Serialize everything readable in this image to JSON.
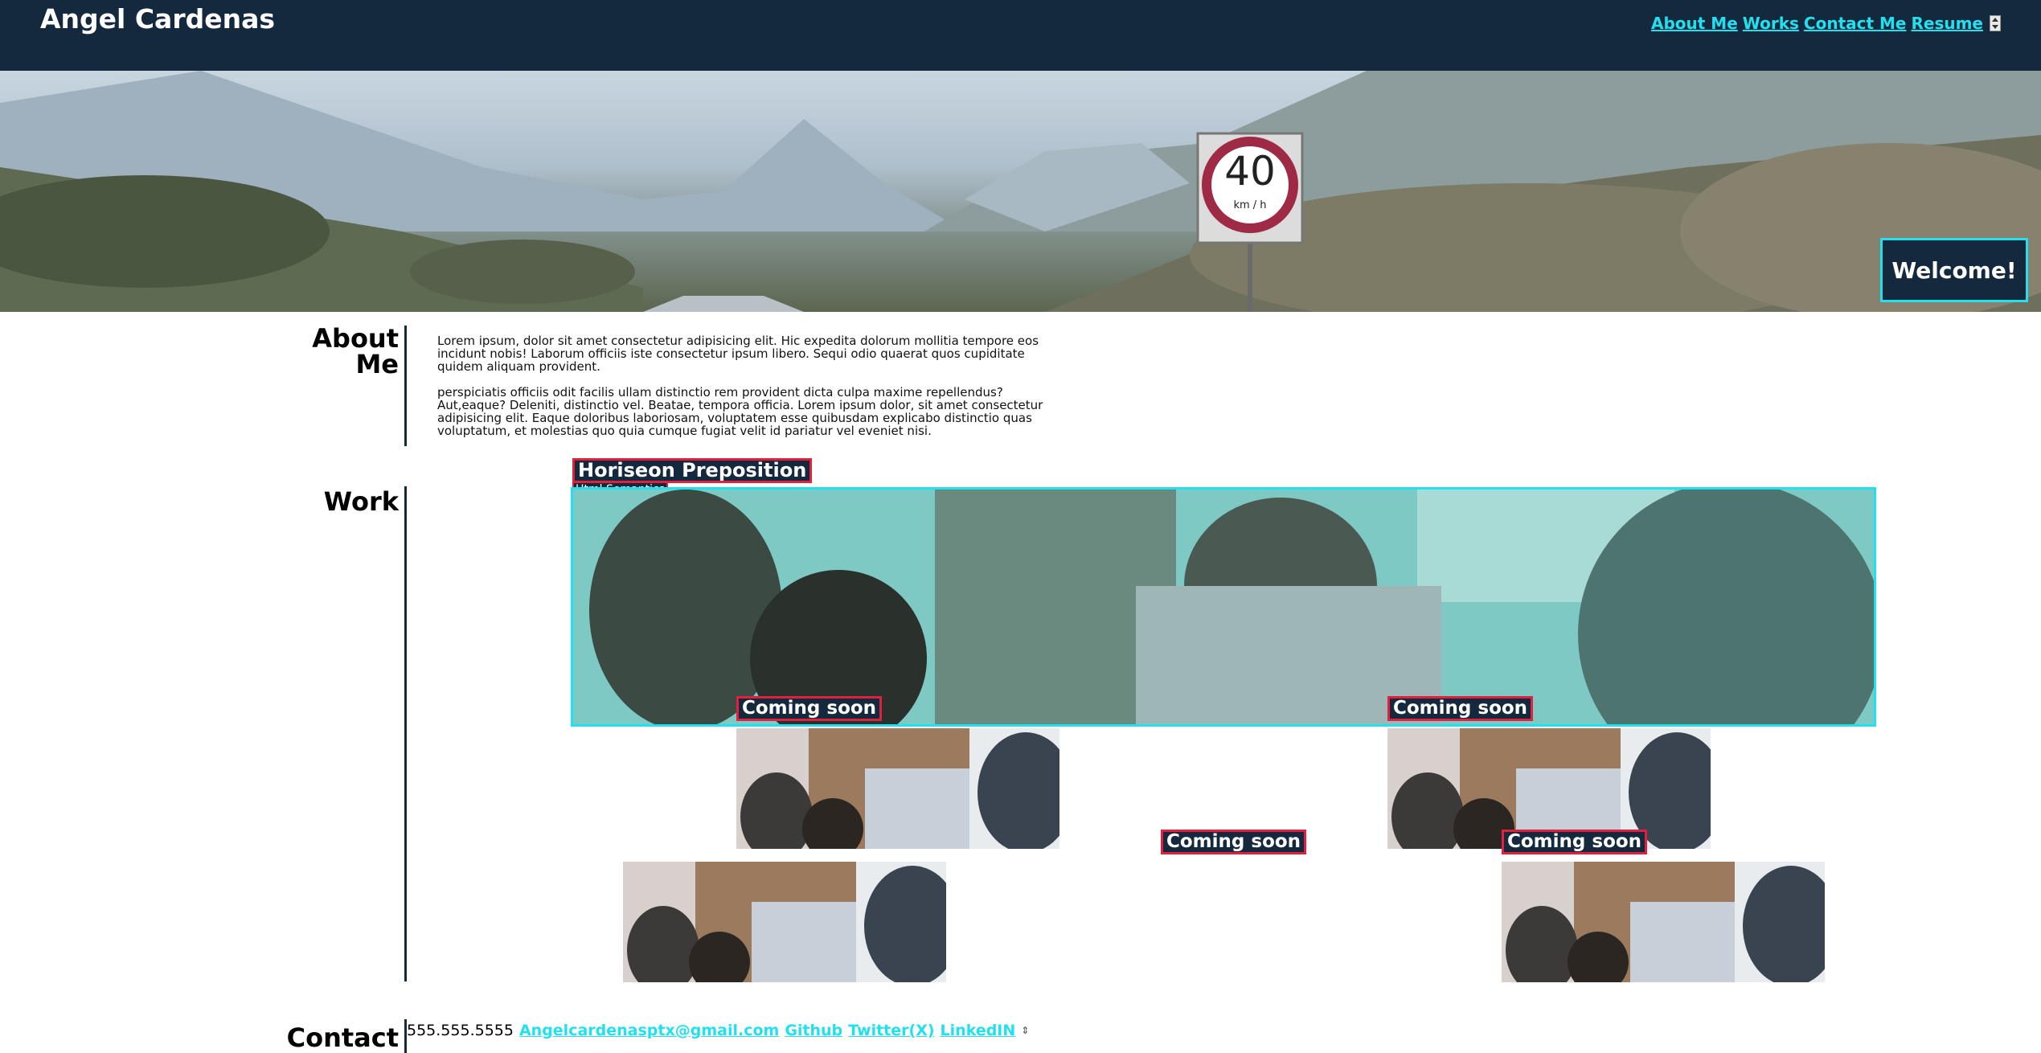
{
  "header": {
    "site_title": "Angel Cardenas",
    "nav": [
      "About Me",
      "Works",
      "Contact Me",
      "Resume"
    ]
  },
  "hero": {
    "sign_number": "40",
    "sign_unit": "km / h",
    "welcome": "Welcome!"
  },
  "about": {
    "title": "About Me",
    "paragraphs": [
      "Lorem ipsum, dolor sit amet consectetur adipisicing elit. Hic expedita dolorum mollitia tempore eos incidunt nobis! Laborum officiis iste consectetur ipsum libero. Sequi odio quaerat quos cupiditate quidem aliquam provident.",
      "perspiciatis officiis odit facilis ullam distinctio rem provident dicta culpa maxime repellendus? Aut,eaque? Deleniti, distinctio vel. Beatae, tempora officia. Lorem ipsum dolor, sit amet consectetur adipisicing elit. Eaque doloribus laboriosam, voluptatem esse quibusdam explicabo distinctio quas voluptatum, et molestias quo quia cumque fugiat velit id pariatur vel eveniet nisi."
    ]
  },
  "work": {
    "title": "Work",
    "featured": {
      "title": "Horiseon Preposition",
      "tag": "Html Semantics"
    },
    "coming_soon": [
      "Coming soon",
      "Coming soon",
      "Coming soon",
      "Coming soon"
    ]
  },
  "contact": {
    "title": "Contact",
    "phone": "555.555.5555",
    "links": [
      "Angelcardenasptx@gmail.com",
      "Github",
      "Twitter(X)",
      "LinkedIN"
    ]
  },
  "colors": {
    "header_bg": "#14283e",
    "accent": "#22e0ee",
    "label_border": "#e0203c"
  },
  "icons": [
    "scroll-spinner-icon",
    "speed-limit-sign"
  ]
}
